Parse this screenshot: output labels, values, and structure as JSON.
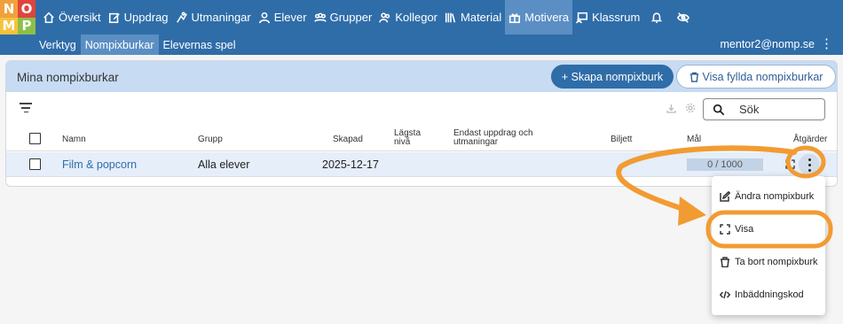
{
  "logo": {
    "letters": [
      "N",
      "O",
      "M",
      "P"
    ],
    "colors": [
      "#f0a13c",
      "#e0443c",
      "#f5c33b",
      "#8cbf4a"
    ]
  },
  "nav": {
    "items": [
      {
        "label": "Översikt",
        "icon": "home-icon"
      },
      {
        "label": "Uppdrag",
        "icon": "edit-icon"
      },
      {
        "label": "Utmaningar",
        "icon": "climb-icon"
      },
      {
        "label": "Elever",
        "icon": "person-icon"
      },
      {
        "label": "Grupper",
        "icon": "people-icon"
      },
      {
        "label": "Kollegor",
        "icon": "colleagues-icon"
      },
      {
        "label": "Material",
        "icon": "library-icon"
      },
      {
        "label": "Motivera",
        "icon": "gift-icon",
        "active": true
      },
      {
        "label": "Klassrum",
        "icon": "classroom-icon"
      }
    ],
    "bell_icon": "bell-icon",
    "eye_off_icon": "eye-off-icon"
  },
  "subnav": {
    "items": [
      {
        "label": "Verktyg"
      },
      {
        "label": "Nompixburkar",
        "active": true
      },
      {
        "label": "Elevernas spel"
      }
    ],
    "user": "mentor2@nomp.se"
  },
  "card": {
    "title": "Mina nompixburkar",
    "create_button": "+ Skapa nompixburk",
    "clear_button": "Visa fyllda nompixburkar",
    "search_placeholder": "Sök"
  },
  "table": {
    "headers": {
      "name": "Namn",
      "group": "Grupp",
      "created": "Skapad",
      "lowest_level": "Lägsta nivå",
      "only_missions": "Endast uppdrag och utmaningar",
      "ticket": "Biljett",
      "goal": "Mål",
      "actions": "Åtgärder"
    },
    "rows": [
      {
        "name": "Film & popcorn",
        "group": "Alla elever",
        "created": "2025-12-17",
        "progress": "0 / 1000"
      }
    ]
  },
  "menu": {
    "items": [
      {
        "label": "Ändra nompixburk",
        "icon": "edit-icon"
      },
      {
        "label": "Visa",
        "icon": "fullscreen-icon"
      },
      {
        "label": "Ta bort nompixburk",
        "icon": "trash-icon"
      },
      {
        "label": "Inbäddningskod",
        "icon": "code-icon"
      }
    ]
  },
  "annotation": {
    "color": "#f29b32"
  }
}
